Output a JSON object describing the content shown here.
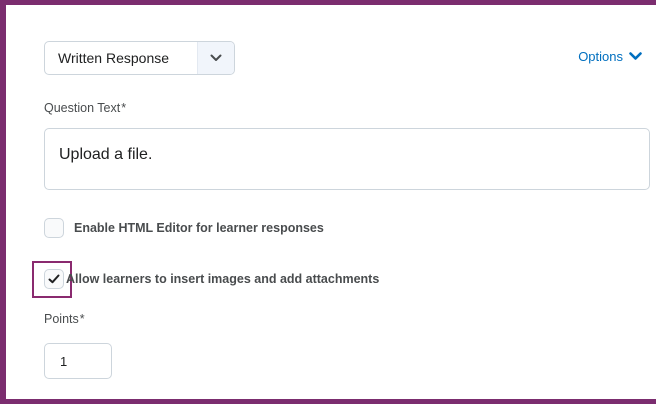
{
  "question_type": {
    "selected": "Written Response"
  },
  "options": {
    "label": "Options"
  },
  "question_text": {
    "label": "Question Text",
    "required_mark": "*",
    "value": "Upload a file."
  },
  "html_editor": {
    "label": "Enable HTML Editor for learner responses",
    "checked": false
  },
  "attachments": {
    "label": "Allow learners to insert images and add attachments",
    "checked": true
  },
  "points": {
    "label": "Points",
    "required_mark": "*",
    "value": "1"
  },
  "colors": {
    "frame_border": "#7b2d6f",
    "highlight": "#8a2a6f",
    "link": "#006fbf"
  }
}
